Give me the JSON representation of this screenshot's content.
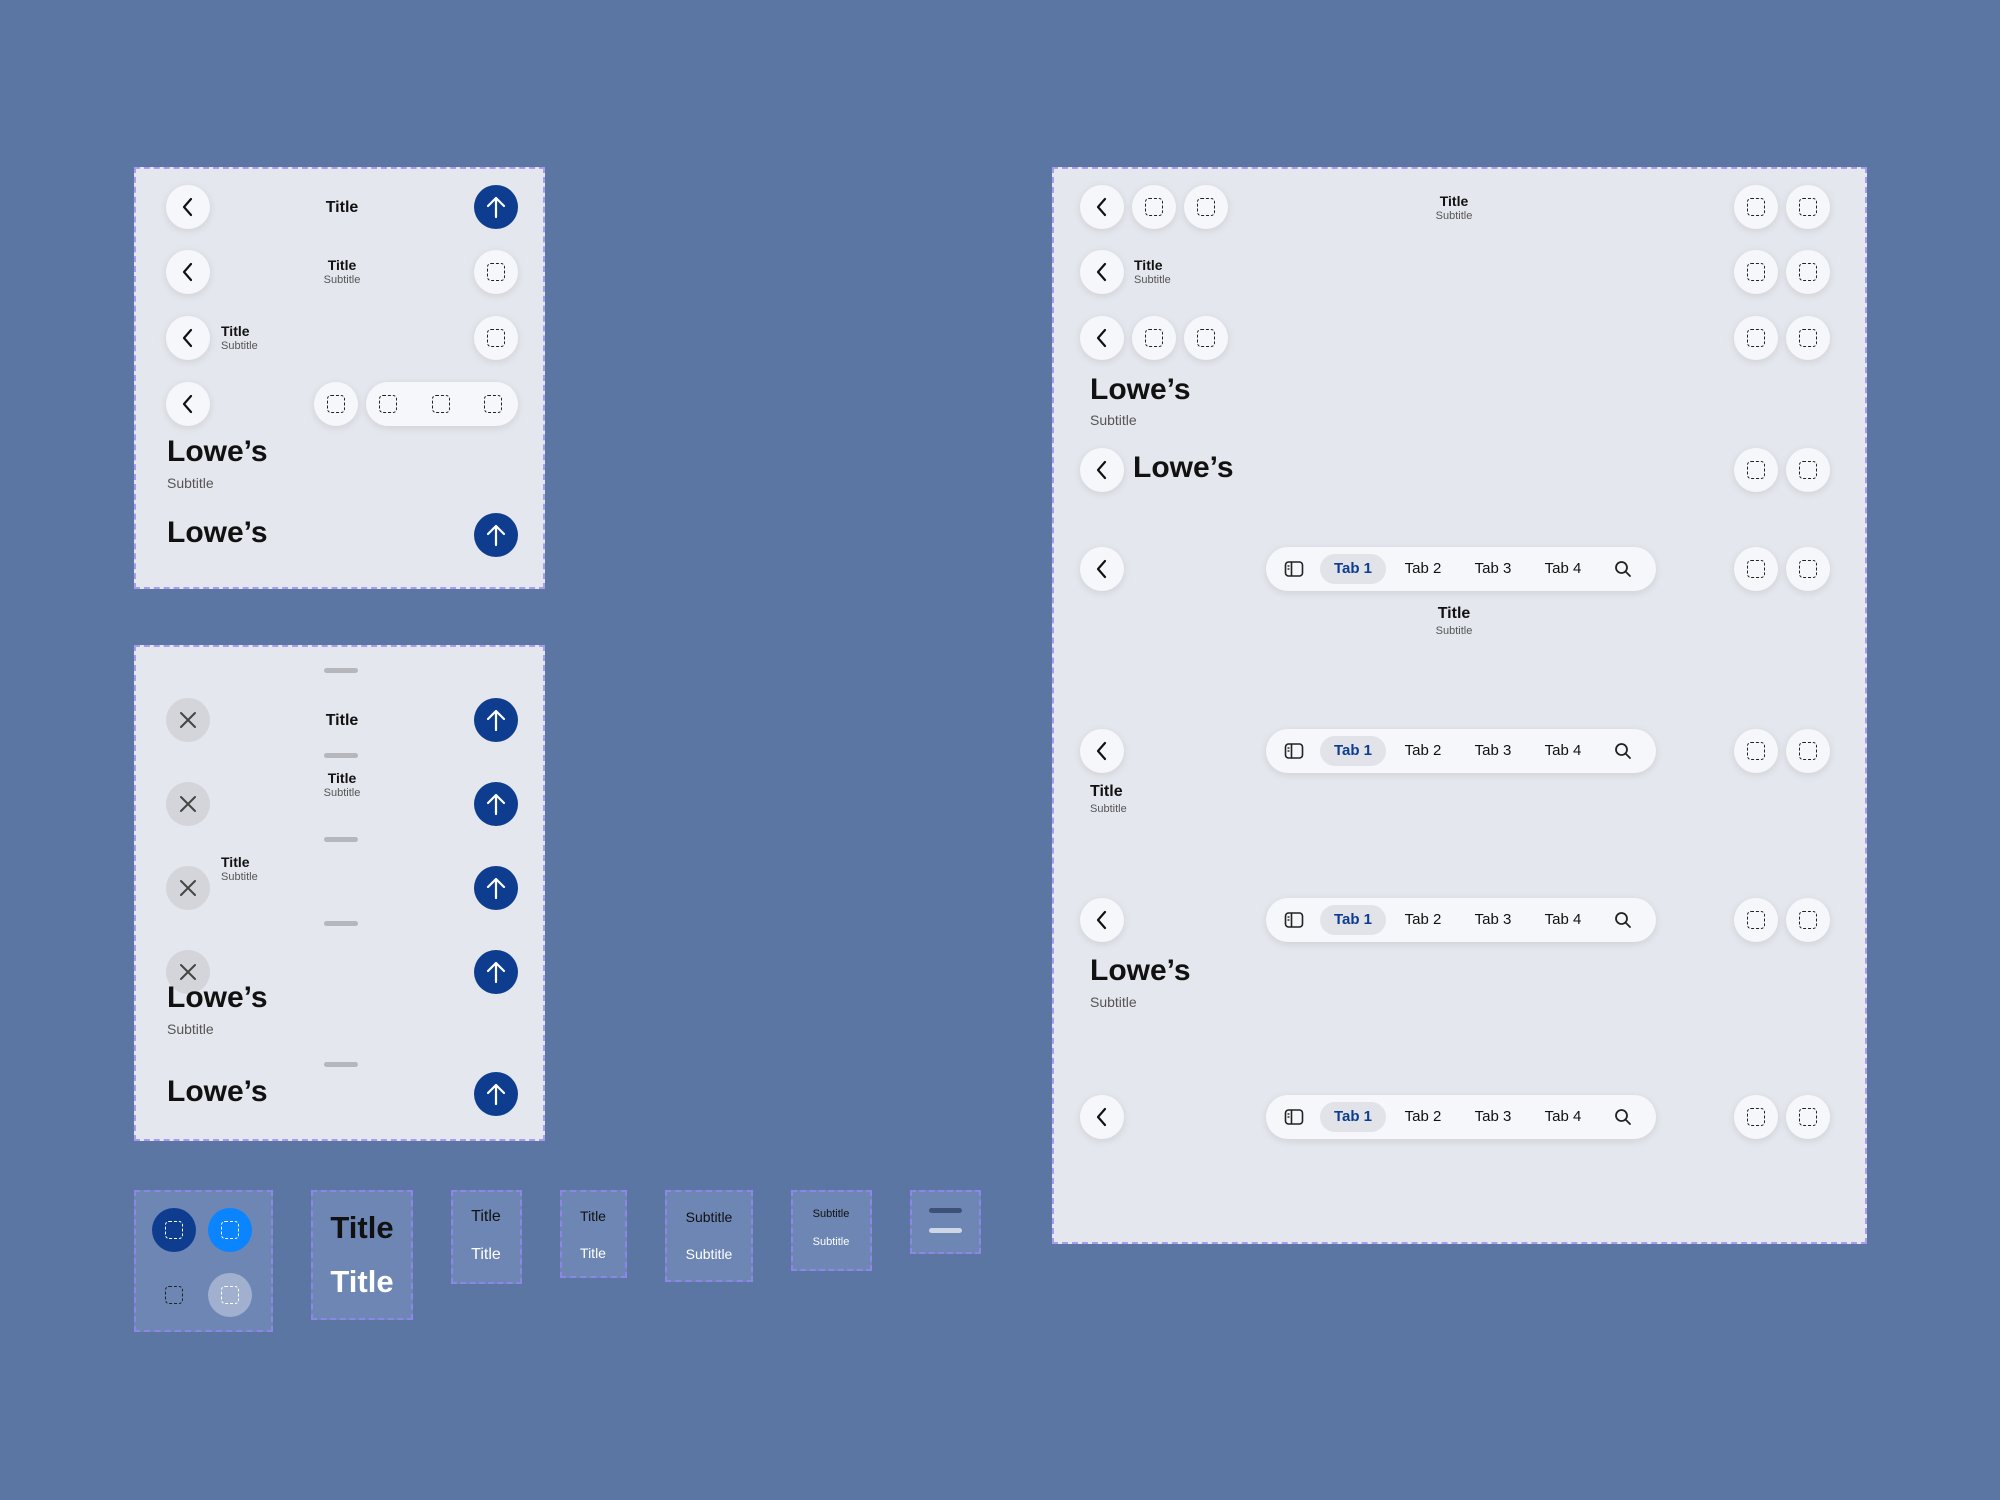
{
  "colors": {
    "background": "#5b76a3",
    "panel": "#e5e7ee",
    "accent": "#0e3d90",
    "accent_bright": "#0a84ff"
  },
  "icons": {
    "back": "chevron-left-icon",
    "close": "close-icon",
    "send": "arrow-up-icon",
    "placeholder": "dashed-square-icon",
    "sidebar": "sidebar-icon",
    "search": "search-icon"
  },
  "top_left_panel": {
    "row1": {
      "title": "Title"
    },
    "row2": {
      "title": "Title",
      "subtitle": "Subtitle"
    },
    "row3": {
      "title": "Title",
      "subtitle": "Subtitle"
    },
    "row4": {
      "large_title": "Lowe’s",
      "subtitle": "Subtitle"
    },
    "row5": {
      "large_title": "Lowe’s"
    }
  },
  "sheet_panel": {
    "row1": {
      "title": "Title"
    },
    "row2": {
      "title": "Title",
      "subtitle": "Subtitle"
    },
    "row3": {
      "title": "Title",
      "subtitle": "Subtitle"
    },
    "row4": {
      "large_title": "Lowe’s",
      "subtitle": "Subtitle"
    },
    "row5": {
      "large_title": "Lowe’s"
    }
  },
  "right_panel": {
    "row1": {
      "title": "Title",
      "subtitle": "Subtitle"
    },
    "row2": {
      "title": "Title",
      "subtitle": "Subtitle"
    },
    "row3": {
      "large_title": "Lowe’s",
      "subtitle": "Subtitle"
    },
    "row4": {
      "large_title": "Lowe’s"
    },
    "tabs": [
      "Tab 1",
      "Tab 2",
      "Tab 3",
      "Tab 4"
    ],
    "row5": {
      "title": "Title",
      "subtitle": "Subtitle"
    },
    "row6": {
      "title": "Title",
      "subtitle": "Subtitle"
    },
    "row7": {
      "large_title": "Lowe’s",
      "subtitle": "Subtitle"
    }
  },
  "swatches": {
    "large_title_1": "Title",
    "large_title_2": "Title",
    "title_a_1": "Title",
    "title_a_2": "Title",
    "title_b_1": "Title",
    "title_b_2": "Title",
    "subtitle_a_1": "Subtitle",
    "subtitle_a_2": "Subtitle",
    "subtitle_b_1": "Subtitle",
    "subtitle_b_2": "Subtitle"
  }
}
